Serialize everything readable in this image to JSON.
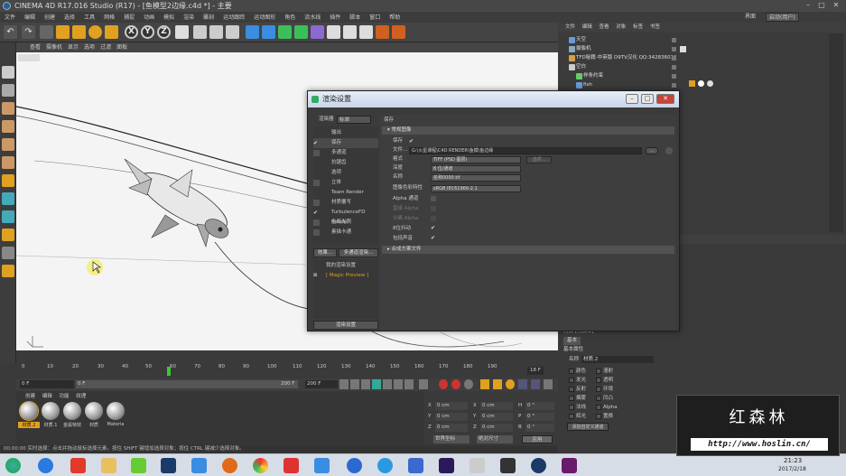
{
  "app": {
    "title": "CINEMA 4D R17.016 Studio (R17) - [鱼模型2边缘.c4d *] - 主要",
    "menus": [
      "文件",
      "编辑",
      "创建",
      "选择",
      "工具",
      "网格",
      "捕捉",
      "动画",
      "模拟",
      "渲染",
      "雕刻",
      "运动跟踪",
      "运动图形",
      "角色",
      "流水线",
      "插件",
      "脚本",
      "窗口",
      "帮助"
    ],
    "layout_label": "界面",
    "layout_value": "启动(用户)"
  },
  "viewport": {
    "menus": [
      "查看",
      "摄像机",
      "显示",
      "选项",
      "过滤",
      "面板"
    ]
  },
  "timeline": {
    "ticks": [
      "0",
      "10",
      "20",
      "30",
      "40",
      "50",
      "60",
      "70",
      "80",
      "90",
      "100",
      "110",
      "120",
      "130",
      "140",
      "150",
      "160",
      "170",
      "180",
      "190"
    ],
    "current_frame": "18 F",
    "start": "0 F",
    "field2": "0 F",
    "end": "200 F",
    "end2": "200 F"
  },
  "material_manager": {
    "menus": [
      "创建",
      "编辑",
      "功能",
      "纹理"
    ],
    "materials": [
      "材质.2",
      "材质.1",
      "金属特效",
      "材质",
      "Materia"
    ]
  },
  "coords": {
    "rows": [
      {
        "a": "X",
        "v1": "0 cm",
        "b": "X",
        "v2": "0 cm",
        "c": "H",
        "v3": "0 °"
      },
      {
        "a": "Y",
        "v1": "0 cm",
        "b": "Y",
        "v2": "0 cm",
        "c": "P",
        "v3": "0 °"
      },
      {
        "a": "Z",
        "v1": "0 cm",
        "b": "Z",
        "v2": "0 cm",
        "c": "B",
        "v3": "0 °"
      }
    ],
    "mode1": "世界坐标",
    "mode2": "绝对尺寸",
    "apply": "应用"
  },
  "status": "00:00:00   实时选择：点击并拖动鼠标选择元素。按住 SHIFT 键增加选择对象；按住 CTRL 键减少选择对象。",
  "object_manager": {
    "menus": [
      "文件",
      "编辑",
      "查看",
      "对象",
      "标签",
      "书签"
    ],
    "objects": [
      {
        "name": "天空",
        "color": "#6a9ad8"
      },
      {
        "name": "摄像机",
        "color": "#8ab"
      },
      {
        "name": "TFD秘籍-中英版 D9TV汉化 QQ:342836011",
        "color": "#d8a040"
      },
      {
        "name": "空白",
        "color": "#ccc"
      },
      {
        "name": "样条约束",
        "color": "#6c6"
      },
      {
        "name": "fish",
        "color": "#6a9ad8"
      }
    ]
  },
  "attribute_manager": {
    "mode": "模式",
    "title_label": "材质 [材质.2]",
    "basic": "基本",
    "basic_attr": "基本属性",
    "name_label": "名称",
    "name_value": "材质.2",
    "channels_left": [
      "颜色",
      "发光",
      "反射",
      "烟雾",
      "法线",
      "辉光"
    ],
    "channels_right": [
      "漫射",
      "透明",
      "环境",
      "凹凸",
      "Alpha",
      "置换"
    ],
    "add_button": "添加自定义通道"
  },
  "render_dialog": {
    "title": "渲染设置",
    "renderer_label": "渲染器",
    "renderer_value": "标准",
    "settings": [
      {
        "label": "输出",
        "checked": false
      },
      {
        "label": "保存",
        "checked": true
      },
      {
        "label": "多通道",
        "checked": false
      },
      {
        "label": "抗锯齿",
        "checked": false
      },
      {
        "label": "选项",
        "checked": false
      },
      {
        "label": "立体",
        "checked": false
      },
      {
        "label": "Team Render",
        "checked": false
      },
      {
        "label": "材质覆写",
        "checked": false
      },
      {
        "label": "TurbulenceFD Rende",
        "checked": true
      },
      {
        "label": "全局光照",
        "checked": false
      },
      {
        "label": "素描卡通",
        "checked": false
      }
    ],
    "effects_button": "效果...",
    "multipass_button": "多通道渲染...",
    "presets": [
      "我的渲染设置",
      "[ Magic Preview ]"
    ],
    "render_setting_button": "渲染设置",
    "right_header": "保存",
    "regular_image": "常规图像",
    "save_label": "保存",
    "file_label": "文件...",
    "file_value": "G:\\火星课程\\C4D RENDER\\鱼模\\鱼边缘",
    "file_button": "...",
    "format_label": "格式",
    "format_value": "TIFF (PSD 图层)",
    "options_button": "选项...",
    "depth_label": "深度",
    "depth_value": "8 位/通道",
    "name_label": "名称",
    "name_value": "名称0000.tif",
    "profile_label": "图像色彩特性",
    "profile_value": "sRGB IEC61966-2.1",
    "alpha_label": "Alpha 通道",
    "straight_alpha_label": "直接 Alpha",
    "separate_alpha_label": "分离 Alpha",
    "dither_label": "8位抖动",
    "sound_label": "包括声音",
    "compositing": "合成方案文件"
  },
  "taskbar": {
    "time": "21:23",
    "date": "2017/2/18"
  },
  "watermark": {
    "title": "红森林",
    "url": "http://www.hoslin.cn/"
  }
}
